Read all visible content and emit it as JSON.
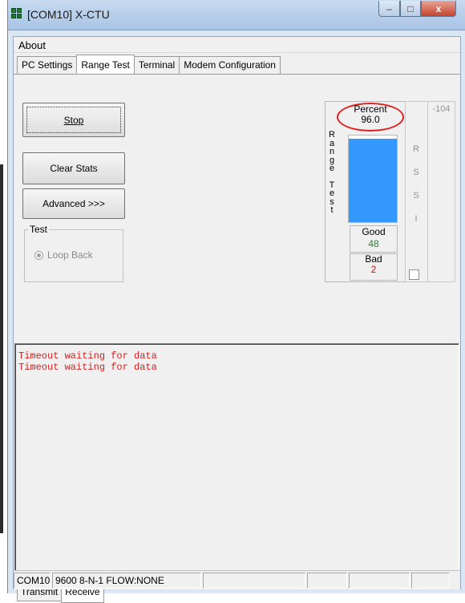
{
  "window": {
    "title": "[COM10] X-CTU",
    "minimize_glyph": "–",
    "maximize_glyph": "□",
    "close_glyph": "x"
  },
  "menu": {
    "about": "About"
  },
  "tabs": [
    {
      "label": "PC Settings",
      "active": false
    },
    {
      "label": "Range Test",
      "active": true
    },
    {
      "label": "Terminal",
      "active": false
    },
    {
      "label": "Modem Configuration",
      "active": false
    }
  ],
  "controls": {
    "stop_label": "Stop",
    "clear_stats_label": "Clear Stats",
    "advanced_label": "Advanced >>>",
    "test_group_title": "Test",
    "loop_back_label": "Loop Back"
  },
  "range_test": {
    "vertical_label": [
      "R",
      "a",
      "n",
      "g",
      "e",
      "",
      "T",
      "e",
      "s",
      "t"
    ],
    "percent_label": "Percent",
    "percent_value": "96.0",
    "percent_fraction": 0.96,
    "good_label": "Good",
    "good_value": "48",
    "bad_label": "Bad",
    "bad_value": "2",
    "bar_color": "#3399ff"
  },
  "rssi": {
    "vertical_label": [
      "R",
      "S",
      "S",
      "I"
    ],
    "value": "-104"
  },
  "terminal": {
    "lines": [
      "Timeout waiting for data",
      "Timeout waiting for data"
    ]
  },
  "bottom_tabs": [
    {
      "label": "Transmit",
      "active": false
    },
    {
      "label": "Receive",
      "active": true
    }
  ],
  "status": {
    "port": "COM10",
    "settings": "9600 8-N-1 FLOW:NONE"
  }
}
